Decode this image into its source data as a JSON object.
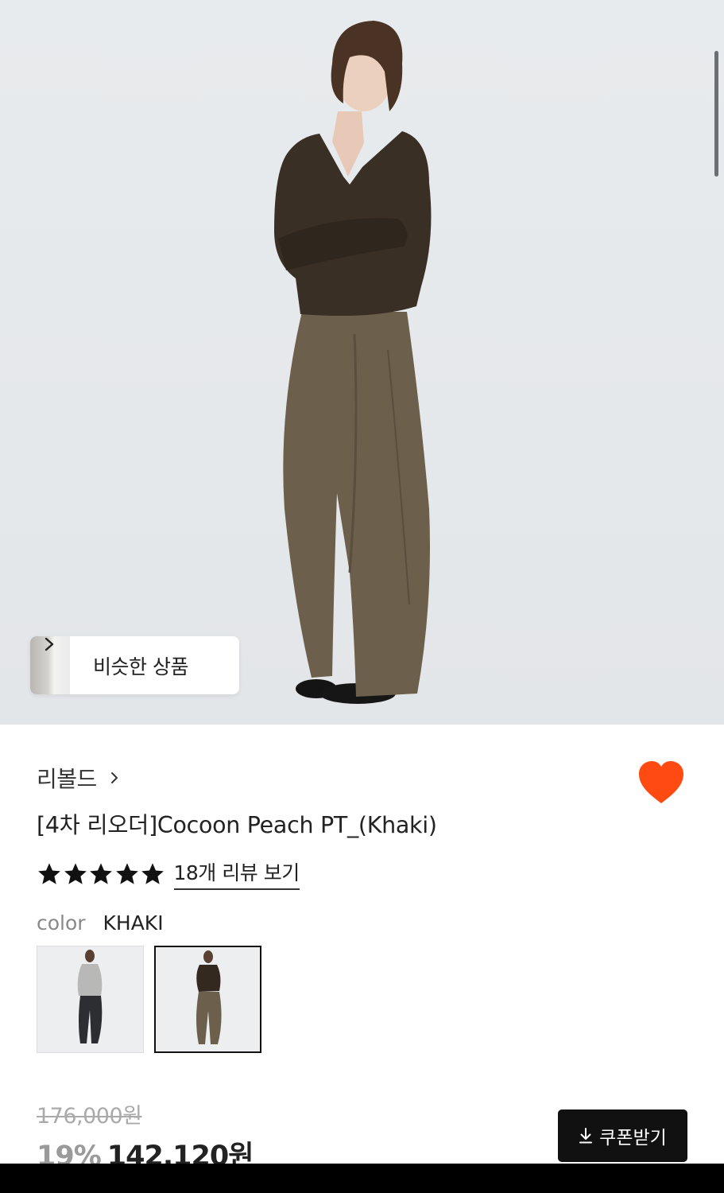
{
  "hero": {
    "image_alt": "Model wearing dark brown knit and khaki wide pants",
    "similar_button": {
      "label": "비슷한 상품"
    }
  },
  "product": {
    "brand": "리볼드",
    "title": "[4차 리오더]Cocoon Peach PT_(Khaki)",
    "rating_stars": 5,
    "reviews_link": "18개 리뷰 보기",
    "color_label": "color",
    "color_value": "KHAKI",
    "swatches": [
      "gray-top-charcoal-pants",
      "brown-top-khaki-pants"
    ],
    "selected_swatch_index": 1,
    "original_price": "176,000원",
    "discount": "19%",
    "sale_price": "142,120원",
    "coupon_button": "쿠폰받기"
  },
  "colors": {
    "heart": "#ff4b12",
    "hero_bg": "#e6e9ec",
    "coupon_bg": "#111111"
  }
}
